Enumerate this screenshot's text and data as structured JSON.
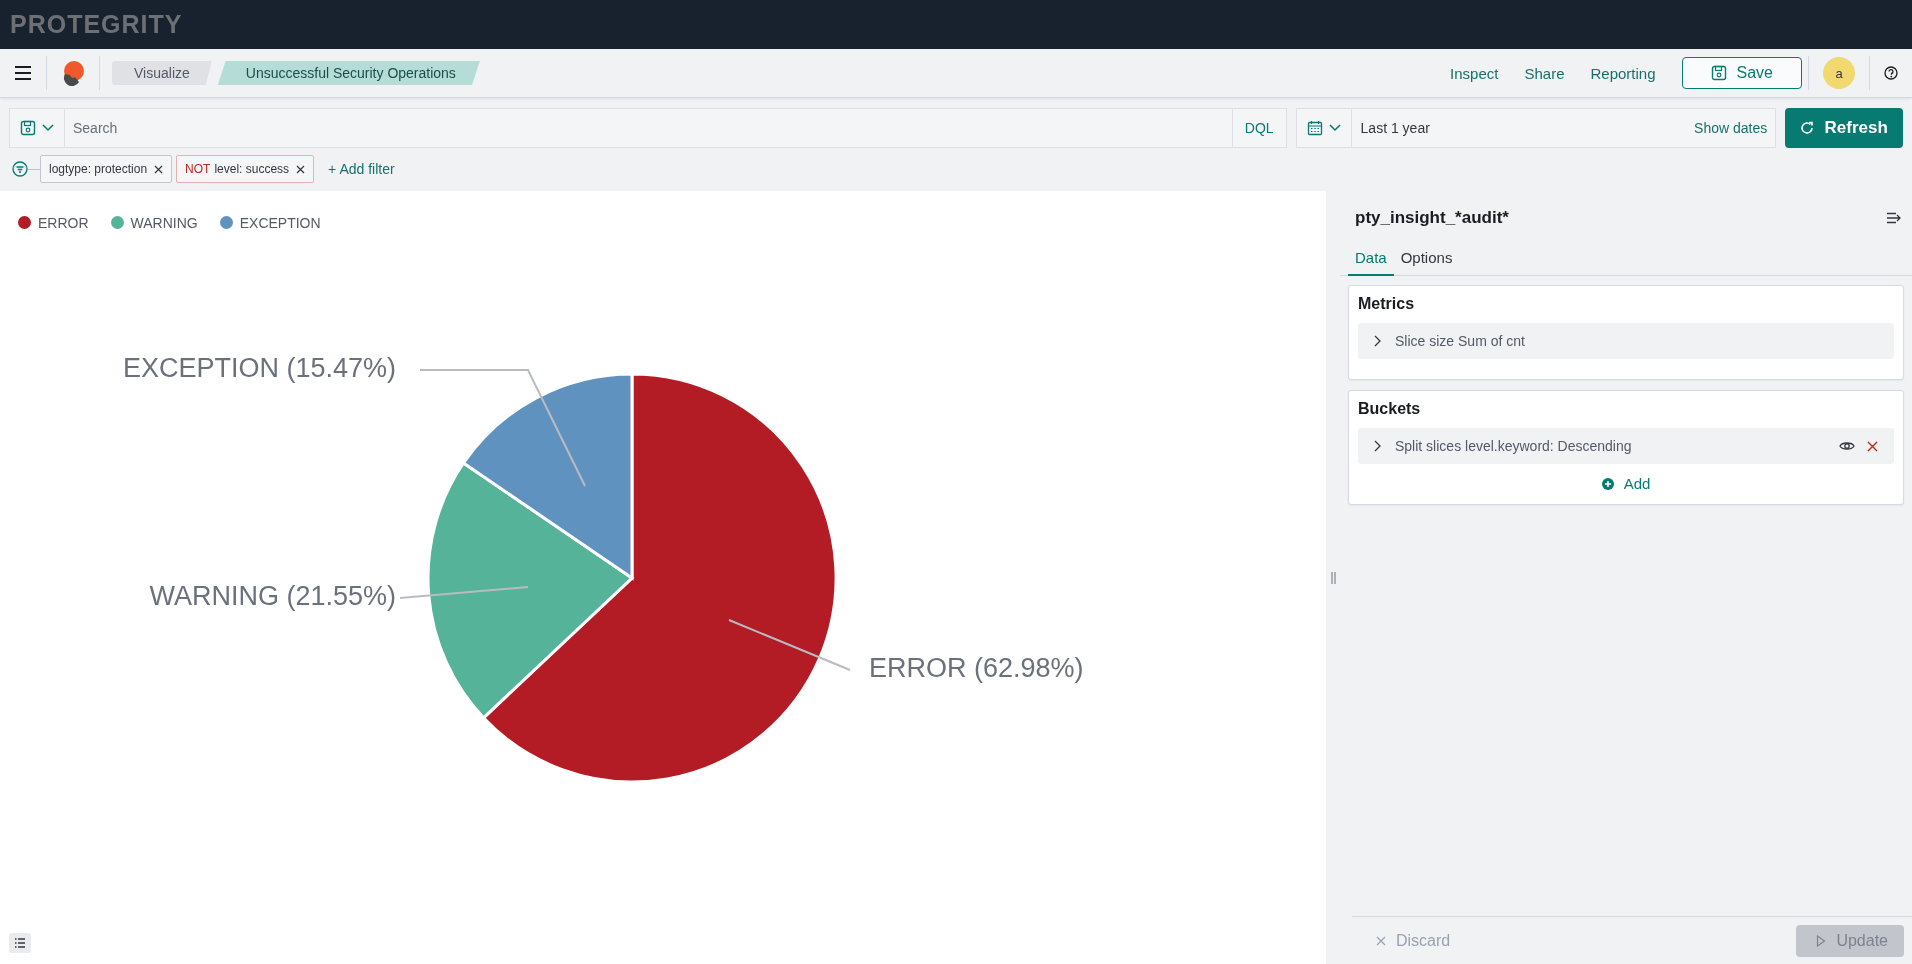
{
  "brand": {
    "logo": "PROTEGRITY"
  },
  "breadcrumbs": [
    {
      "label": "Visualize",
      "selected": false
    },
    {
      "label": "Unsuccessful Security Operations",
      "selected": true
    }
  ],
  "header_links": [
    "Inspect",
    "Share",
    "Reporting"
  ],
  "save_button": "Save",
  "avatar": "a",
  "query": {
    "placeholder": "Search",
    "language": "DQL"
  },
  "time": {
    "range": "Last 1 year",
    "show_dates": "Show dates"
  },
  "refresh_button": "Refresh",
  "filters": [
    {
      "label": "logtype: protection",
      "negated": false
    },
    {
      "label": "level: success",
      "negated": true,
      "prefix": "NOT"
    }
  ],
  "add_filter": "+ Add filter",
  "chart": {
    "legend": [
      {
        "color": "#b31b25"
      },
      {
        "color": "#54b399"
      },
      {
        "color": "#6092c0"
      }
    ],
    "chart_data": {
      "type": "pie",
      "categories": [
        "ERROR",
        "WARNING",
        "EXCEPTION"
      ],
      "values": [
        62.98,
        21.55,
        15.47
      ],
      "value_labels": [
        "ERROR (62.98%)",
        "WARNING (21.55%)",
        "EXCEPTION (15.47%)"
      ]
    }
  },
  "panel": {
    "title": "pty_insight_*audit*",
    "tabs": [
      {
        "label": "Data",
        "selected": true
      },
      {
        "label": "Options",
        "selected": false
      }
    ],
    "sections": [
      {
        "title": "Metrics",
        "items": [
          {
            "label": "Slice size Sum of cnt",
            "actions": false
          }
        ]
      },
      {
        "title": "Buckets",
        "items": [
          {
            "label": "Split slices level.keyword: Descending",
            "actions": true
          }
        ],
        "add": "Add"
      }
    ],
    "discard": "Discard",
    "update": {
      "label": "Update",
      "disabled": true
    }
  }
}
